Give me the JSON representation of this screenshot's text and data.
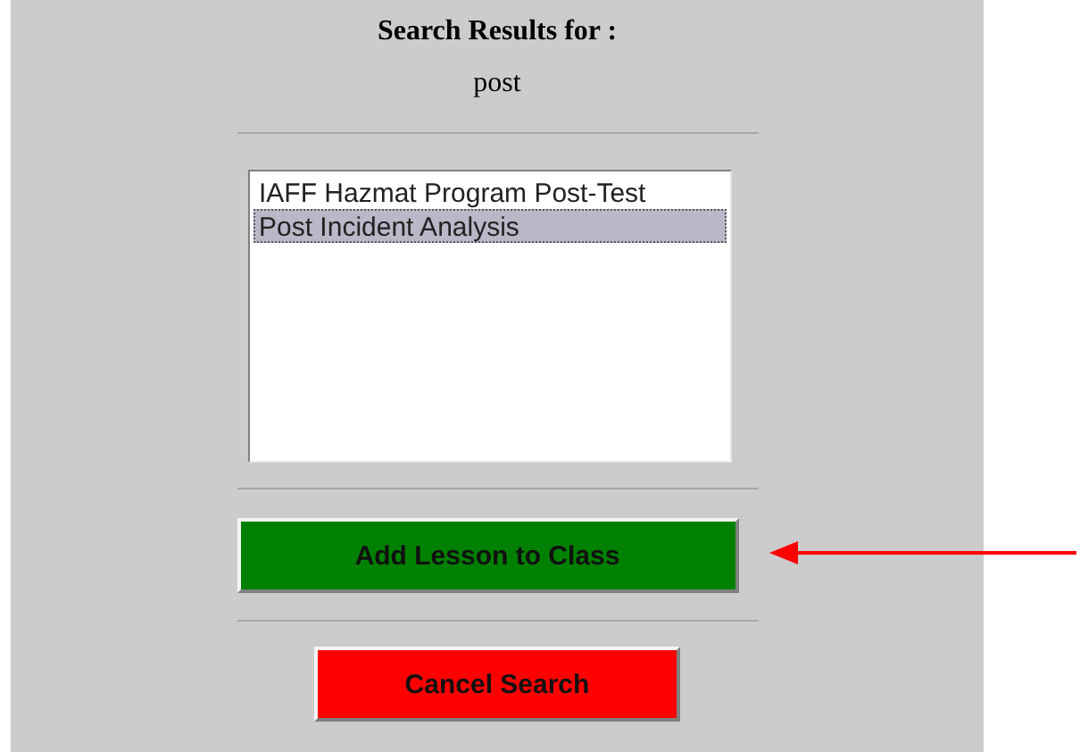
{
  "heading": "Search Results for :",
  "query": "post",
  "results": [
    {
      "label": "IAFF Hazmat Program Post-Test",
      "selected": false
    },
    {
      "label": "Post Incident Analysis",
      "selected": true
    }
  ],
  "buttons": [
    {
      "label": "Add Lesson to Class",
      "color": "#008000"
    },
    {
      "label": "Cancel Search",
      "color": "#ff0000"
    }
  ]
}
